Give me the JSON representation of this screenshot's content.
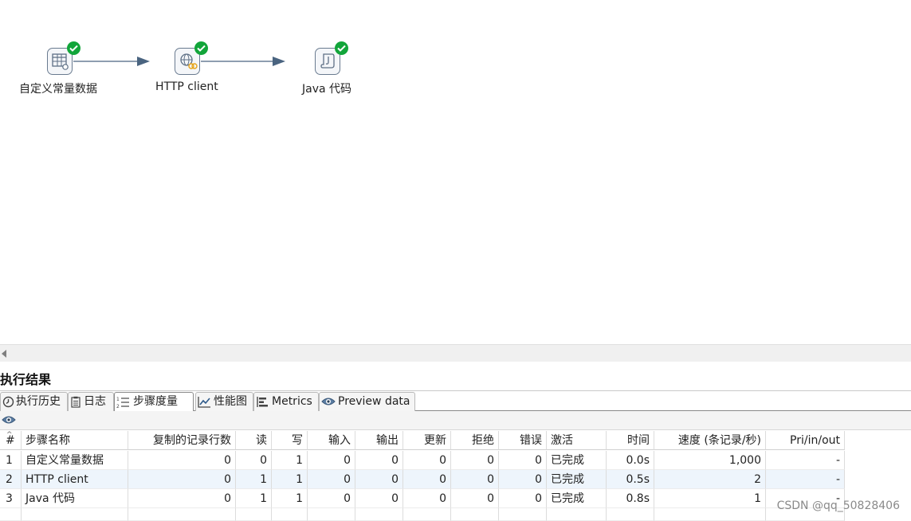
{
  "steps": [
    {
      "label": "自定义常量数据",
      "icon": "constant-table-icon",
      "status_icon": "check-icon"
    },
    {
      "label": "HTTP client",
      "icon": "http-globe-icon",
      "status_icon": "check-icon"
    },
    {
      "label": "Java 代码",
      "icon": "java-scroll-icon",
      "status_icon": "check-icon"
    }
  ],
  "colors": {
    "accent": "#12a53a",
    "hop": "#4a6480",
    "alt_row": "#eef5fc"
  },
  "results": {
    "title": "执行结果",
    "tabs": [
      {
        "label": "执行历史",
        "icon": "history-clock-icon"
      },
      {
        "label": "日志",
        "icon": "log-clipboard-icon"
      },
      {
        "label": "步骤度量",
        "icon": "step-metrics-list-icon",
        "active": true
      },
      {
        "label": "性能图",
        "icon": "performance-chart-icon"
      },
      {
        "label": "Metrics",
        "icon": "metrics-bars-icon"
      },
      {
        "label": "Preview data",
        "icon": "preview-eye-icon"
      }
    ],
    "toolbar_icon": "eye-icon",
    "columns": [
      "#",
      "步骤名称",
      "复制的记录行数",
      "读",
      "写",
      "输入",
      "输出",
      "更新",
      "拒绝",
      "错误",
      "激活",
      "时间",
      "速度 (条记录/秒)",
      "Pri/in/out"
    ],
    "sort_indicator": "^",
    "rows": [
      [
        "1",
        "自定义常量数据",
        "0",
        "0",
        "1",
        "0",
        "0",
        "0",
        "0",
        "0",
        "已完成",
        "0.0s",
        "1,000",
        "-"
      ],
      [
        "2",
        "HTTP client",
        "0",
        "1",
        "1",
        "0",
        "0",
        "0",
        "0",
        "0",
        "已完成",
        "0.5s",
        "2",
        "-"
      ],
      [
        "3",
        "Java 代码",
        "0",
        "1",
        "1",
        "0",
        "0",
        "0",
        "0",
        "0",
        "已完成",
        "0.8s",
        "1",
        "-"
      ]
    ]
  },
  "watermark": "CSDN @qq_50828406"
}
